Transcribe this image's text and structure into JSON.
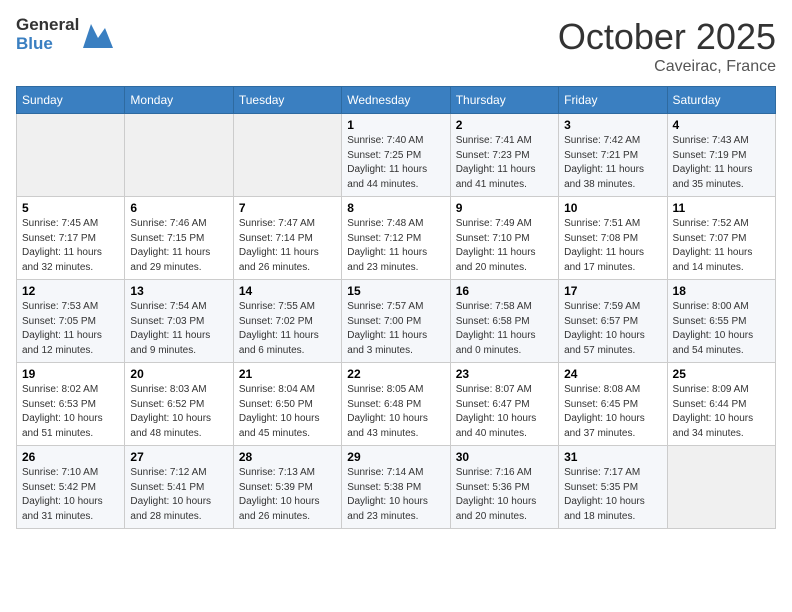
{
  "header": {
    "logo_general": "General",
    "logo_blue": "Blue",
    "title": "October 2025",
    "subtitle": "Caveirac, France"
  },
  "days_of_week": [
    "Sunday",
    "Monday",
    "Tuesday",
    "Wednesday",
    "Thursday",
    "Friday",
    "Saturday"
  ],
  "weeks": [
    [
      {
        "day": "",
        "info": ""
      },
      {
        "day": "",
        "info": ""
      },
      {
        "day": "",
        "info": ""
      },
      {
        "day": "1",
        "info": "Sunrise: 7:40 AM\nSunset: 7:25 PM\nDaylight: 11 hours\nand 44 minutes."
      },
      {
        "day": "2",
        "info": "Sunrise: 7:41 AM\nSunset: 7:23 PM\nDaylight: 11 hours\nand 41 minutes."
      },
      {
        "day": "3",
        "info": "Sunrise: 7:42 AM\nSunset: 7:21 PM\nDaylight: 11 hours\nand 38 minutes."
      },
      {
        "day": "4",
        "info": "Sunrise: 7:43 AM\nSunset: 7:19 PM\nDaylight: 11 hours\nand 35 minutes."
      }
    ],
    [
      {
        "day": "5",
        "info": "Sunrise: 7:45 AM\nSunset: 7:17 PM\nDaylight: 11 hours\nand 32 minutes."
      },
      {
        "day": "6",
        "info": "Sunrise: 7:46 AM\nSunset: 7:15 PM\nDaylight: 11 hours\nand 29 minutes."
      },
      {
        "day": "7",
        "info": "Sunrise: 7:47 AM\nSunset: 7:14 PM\nDaylight: 11 hours\nand 26 minutes."
      },
      {
        "day": "8",
        "info": "Sunrise: 7:48 AM\nSunset: 7:12 PM\nDaylight: 11 hours\nand 23 minutes."
      },
      {
        "day": "9",
        "info": "Sunrise: 7:49 AM\nSunset: 7:10 PM\nDaylight: 11 hours\nand 20 minutes."
      },
      {
        "day": "10",
        "info": "Sunrise: 7:51 AM\nSunset: 7:08 PM\nDaylight: 11 hours\nand 17 minutes."
      },
      {
        "day": "11",
        "info": "Sunrise: 7:52 AM\nSunset: 7:07 PM\nDaylight: 11 hours\nand 14 minutes."
      }
    ],
    [
      {
        "day": "12",
        "info": "Sunrise: 7:53 AM\nSunset: 7:05 PM\nDaylight: 11 hours\nand 12 minutes."
      },
      {
        "day": "13",
        "info": "Sunrise: 7:54 AM\nSunset: 7:03 PM\nDaylight: 11 hours\nand 9 minutes."
      },
      {
        "day": "14",
        "info": "Sunrise: 7:55 AM\nSunset: 7:02 PM\nDaylight: 11 hours\nand 6 minutes."
      },
      {
        "day": "15",
        "info": "Sunrise: 7:57 AM\nSunset: 7:00 PM\nDaylight: 11 hours\nand 3 minutes."
      },
      {
        "day": "16",
        "info": "Sunrise: 7:58 AM\nSunset: 6:58 PM\nDaylight: 11 hours\nand 0 minutes."
      },
      {
        "day": "17",
        "info": "Sunrise: 7:59 AM\nSunset: 6:57 PM\nDaylight: 10 hours\nand 57 minutes."
      },
      {
        "day": "18",
        "info": "Sunrise: 8:00 AM\nSunset: 6:55 PM\nDaylight: 10 hours\nand 54 minutes."
      }
    ],
    [
      {
        "day": "19",
        "info": "Sunrise: 8:02 AM\nSunset: 6:53 PM\nDaylight: 10 hours\nand 51 minutes."
      },
      {
        "day": "20",
        "info": "Sunrise: 8:03 AM\nSunset: 6:52 PM\nDaylight: 10 hours\nand 48 minutes."
      },
      {
        "day": "21",
        "info": "Sunrise: 8:04 AM\nSunset: 6:50 PM\nDaylight: 10 hours\nand 45 minutes."
      },
      {
        "day": "22",
        "info": "Sunrise: 8:05 AM\nSunset: 6:48 PM\nDaylight: 10 hours\nand 43 minutes."
      },
      {
        "day": "23",
        "info": "Sunrise: 8:07 AM\nSunset: 6:47 PM\nDaylight: 10 hours\nand 40 minutes."
      },
      {
        "day": "24",
        "info": "Sunrise: 8:08 AM\nSunset: 6:45 PM\nDaylight: 10 hours\nand 37 minutes."
      },
      {
        "day": "25",
        "info": "Sunrise: 8:09 AM\nSunset: 6:44 PM\nDaylight: 10 hours\nand 34 minutes."
      }
    ],
    [
      {
        "day": "26",
        "info": "Sunrise: 7:10 AM\nSunset: 5:42 PM\nDaylight: 10 hours\nand 31 minutes."
      },
      {
        "day": "27",
        "info": "Sunrise: 7:12 AM\nSunset: 5:41 PM\nDaylight: 10 hours\nand 28 minutes."
      },
      {
        "day": "28",
        "info": "Sunrise: 7:13 AM\nSunset: 5:39 PM\nDaylight: 10 hours\nand 26 minutes."
      },
      {
        "day": "29",
        "info": "Sunrise: 7:14 AM\nSunset: 5:38 PM\nDaylight: 10 hours\nand 23 minutes."
      },
      {
        "day": "30",
        "info": "Sunrise: 7:16 AM\nSunset: 5:36 PM\nDaylight: 10 hours\nand 20 minutes."
      },
      {
        "day": "31",
        "info": "Sunrise: 7:17 AM\nSunset: 5:35 PM\nDaylight: 10 hours\nand 18 minutes."
      },
      {
        "day": "",
        "info": ""
      }
    ]
  ]
}
